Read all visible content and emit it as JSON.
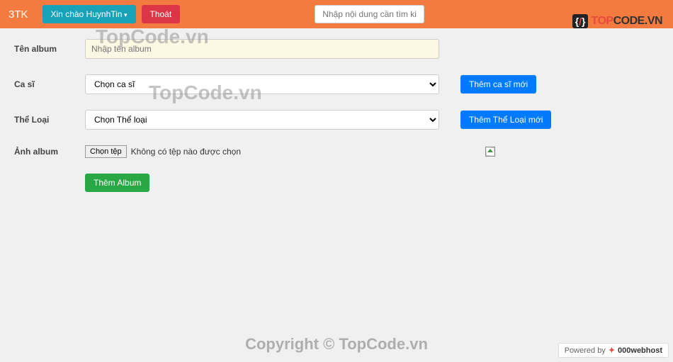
{
  "navbar": {
    "brand": "3TK",
    "greeting": "Xin chào HuynhTin",
    "logout": "Thoát",
    "search_placeholder": "Nhập nội dung cần tìm kiếm"
  },
  "logo": {
    "badge_left": "{",
    "badge_slash": "/",
    "badge_right": "}",
    "text_red": "TOP",
    "text_dark": "CODE.VN"
  },
  "form": {
    "album_name_label": "Tên album",
    "album_name_placeholder": "Nhập tên album",
    "singer_label": "Ca sĩ",
    "singer_option": "Chọn ca sĩ",
    "add_singer": "Thêm ca sĩ mới",
    "genre_label": "Thể Loại",
    "genre_option": "Chọn Thể loại",
    "add_genre": "Thêm Thể Loại mới",
    "image_label": "Ảnh album",
    "file_button": "Chọn tệp",
    "file_none": "Không có tệp nào được chọn",
    "submit": "Thêm Album"
  },
  "watermark": {
    "wm1": "TopCode.vn",
    "wm2": "TopCode.vn",
    "copyright": "Copyright © TopCode.vn"
  },
  "footer": {
    "powered_prefix": "Powered by",
    "powered_brand": "000webhost"
  }
}
